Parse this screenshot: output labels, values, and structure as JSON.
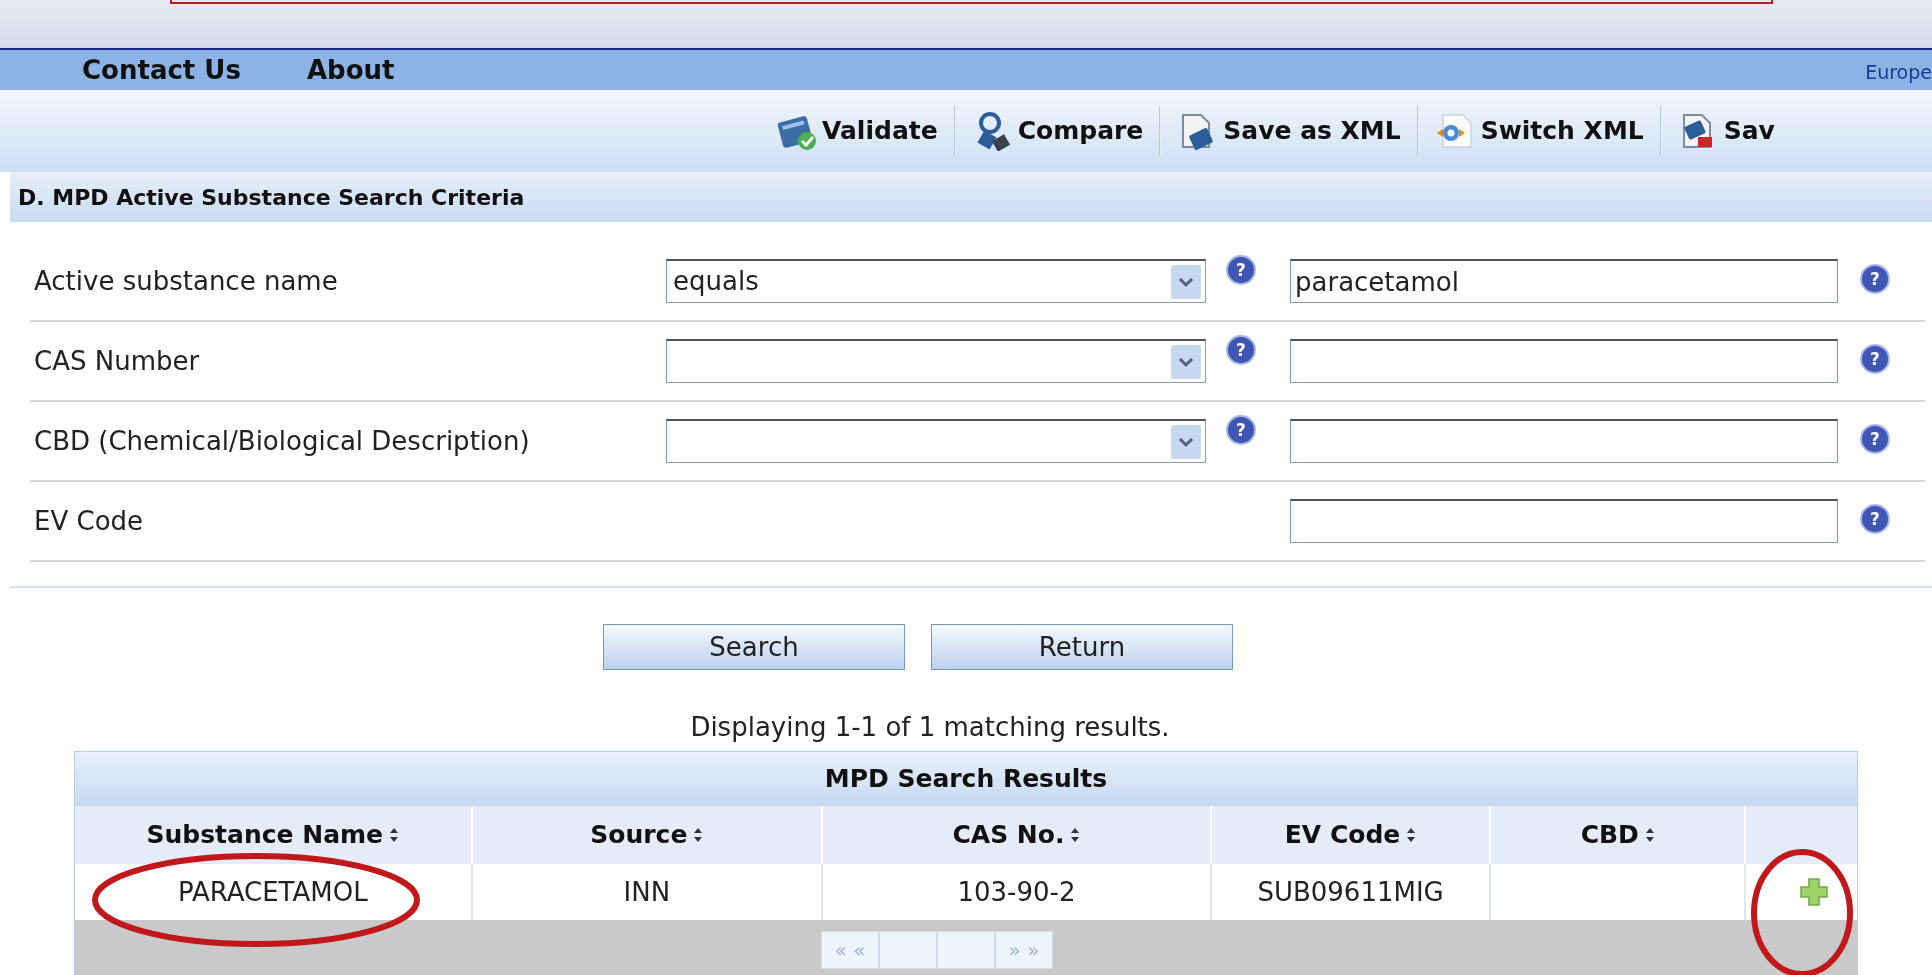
{
  "nav": {
    "links": [
      "Contact Us",
      "About"
    ],
    "right_text": "Europe"
  },
  "toolbar": [
    {
      "kind": "validate",
      "label": "Validate"
    },
    {
      "kind": "compare",
      "label": "Compare"
    },
    {
      "kind": "save_xml",
      "label": "Save as XML"
    },
    {
      "kind": "switch_xml",
      "label": "Switch XML"
    },
    {
      "kind": "save",
      "label": "Sav"
    }
  ],
  "section_title": "D. MPD Active Substance Search Criteria",
  "criteria": [
    {
      "kind": "select_input",
      "label": "Active substance name",
      "operator": "equals",
      "operator_help": "?",
      "value": "paracetamol",
      "value_help": "?"
    },
    {
      "kind": "select_input",
      "label": "CAS Number",
      "operator_help": "?",
      "value_help": "?"
    },
    {
      "kind": "select_input",
      "label": "CBD (Chemical/Biological Description)",
      "operator_help": "?",
      "value_help": "?"
    },
    {
      "kind": "input",
      "label": "EV Code",
      "value_help": "?"
    }
  ],
  "buttons": [
    "Search",
    "Return"
  ],
  "summary": "Displaying 1-1 of 1 matching results.",
  "results": {
    "title": "MPD Search Results",
    "columns": [
      "Substance Name",
      "Source",
      "CAS No.",
      "EV Code",
      "CBD"
    ],
    "rows": [
      {
        "cells": [
          "PARACETAMOL",
          "INN",
          "103-90-2",
          "SUB09611MIG"
        ],
        "name_circled": true,
        "add_circled": true
      }
    ],
    "pager": {
      "back": "« «",
      "forward": "» »"
    }
  }
}
